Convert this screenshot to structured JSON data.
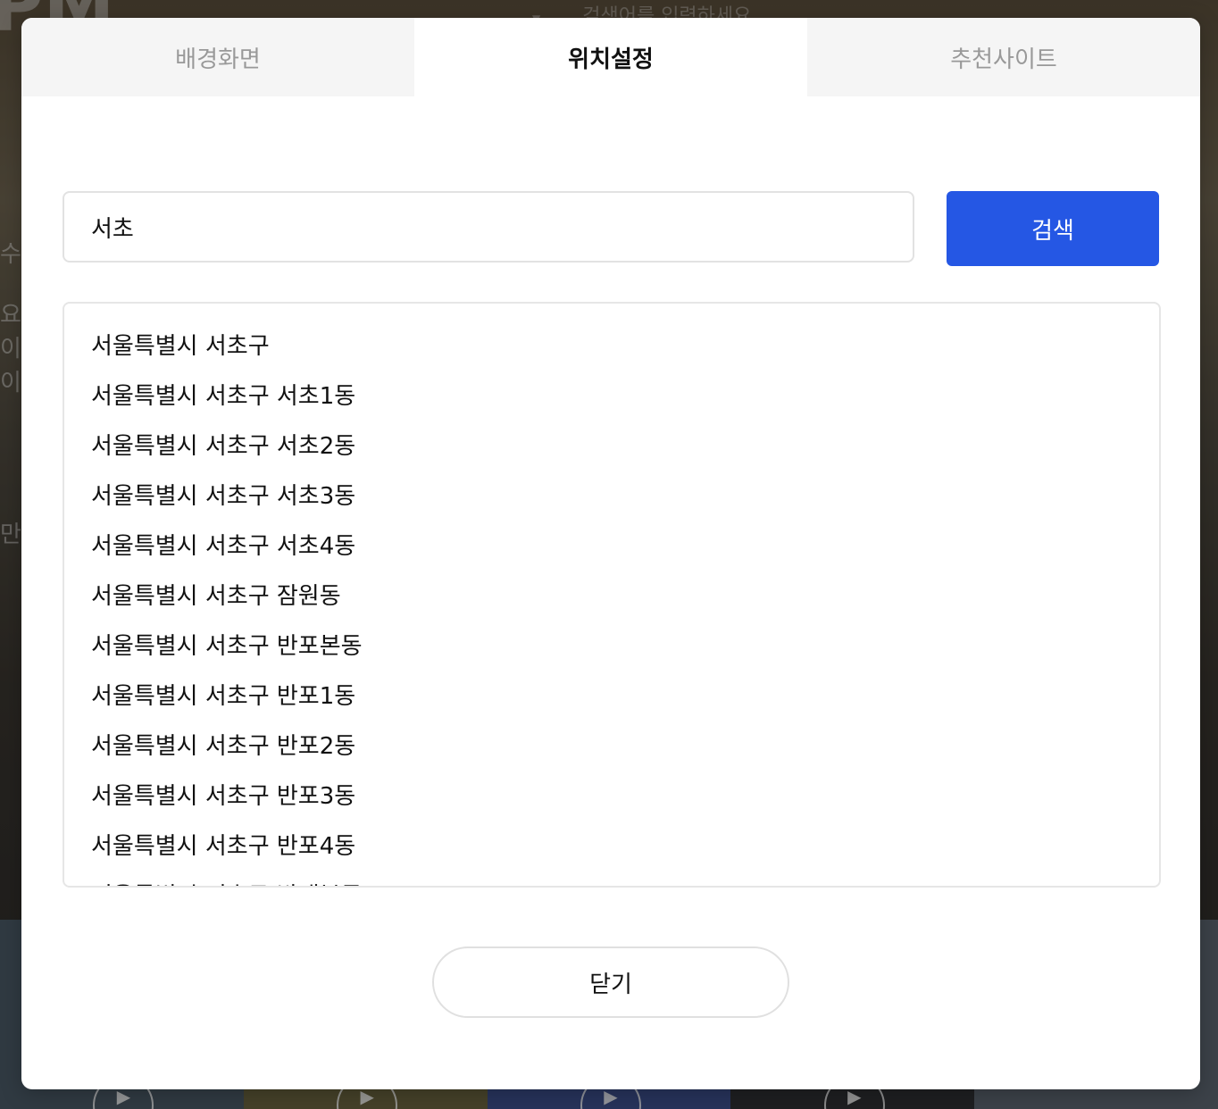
{
  "background": {
    "clock_text": "PM",
    "search_placeholder": "검색어를 입력하세요",
    "left_fragments": [
      "수",
      "요.",
      "이",
      "이",
      "만추"
    ]
  },
  "modal": {
    "tabs": [
      {
        "label": "배경화면",
        "active": false
      },
      {
        "label": "위치설정",
        "active": true
      },
      {
        "label": "추천사이트",
        "active": false
      }
    ],
    "search": {
      "value": "서초",
      "button_label": "검색"
    },
    "results": [
      "서울특별시 서초구",
      "서울특별시 서초구 서초1동",
      "서울특별시 서초구 서초2동",
      "서울특별시 서초구 서초3동",
      "서울특별시 서초구 서초4동",
      "서울특별시 서초구 잠원동",
      "서울특별시 서초구 반포본동",
      "서울특별시 서초구 반포1동",
      "서울특별시 서초구 반포2동",
      "서울특별시 서초구 반포3동",
      "서울특별시 서초구 반포4동",
      "서울특별시 서초구 방배본동"
    ],
    "close_label": "닫기"
  },
  "colors": {
    "accent": "#2557e4",
    "inactive_tab_bg": "#f5f5f5",
    "inactive_tab_text": "#999999"
  }
}
